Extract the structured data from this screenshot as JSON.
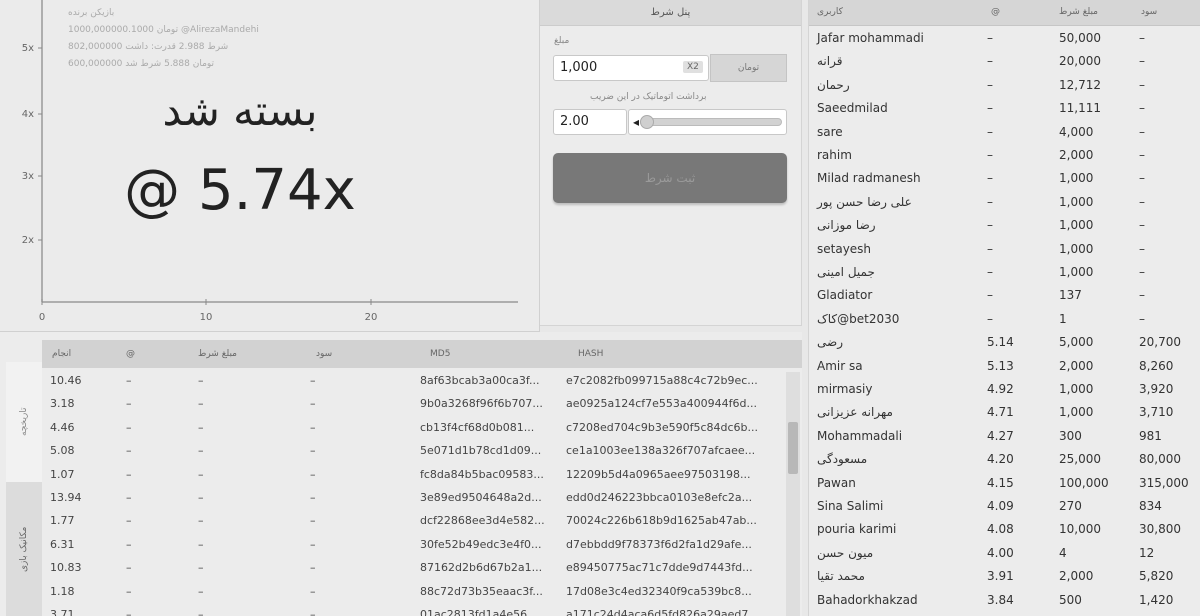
{
  "chart": {
    "info_lines": [
      "بازیکن برنده",
      "1000,000000.1000 تومان @AlirezaMandehi",
      "802,000000 شرط 2.988 قدرت: داشت",
      "600,000000 تومان 5.888 شرط شد"
    ],
    "crash_status": "بسته شد",
    "crash_value": "@ 5.74x"
  },
  "chart_data": {
    "type": "line",
    "title": "",
    "yticks": [
      "5x",
      "4x",
      "3x",
      "2x"
    ],
    "xticks": [
      "0",
      "10",
      "20"
    ],
    "final_multiplier": 5.74,
    "series": []
  },
  "bet": {
    "title": "پنل شرط",
    "amount_label": "مبلغ",
    "amount_value": "1,000",
    "amount_unit": "X2",
    "amount_side_btn": "تومان",
    "auto_label": "برداشت اتوماتیک در این ضریب",
    "auto_value": "2.00",
    "place_button": "ثبت شرط"
  },
  "players": {
    "headers": {
      "user": "کاربری",
      "multiplier": "@",
      "bet": "مبلغ شرط",
      "profit": "سود"
    },
    "rows": [
      {
        "user": "Jafar mohammadi",
        "mult": "–",
        "bet": "50,000",
        "profit": "–"
      },
      {
        "user": "قرانه",
        "mult": "–",
        "bet": "20,000",
        "profit": "–"
      },
      {
        "user": "رحمان",
        "mult": "–",
        "bet": "12,712",
        "profit": "–"
      },
      {
        "user": "Saeedmilad",
        "mult": "–",
        "bet": "11,111",
        "profit": "–"
      },
      {
        "user": "sare",
        "mult": "–",
        "bet": "4,000",
        "profit": "–"
      },
      {
        "user": "rahim",
        "mult": "–",
        "bet": "2,000",
        "profit": "–"
      },
      {
        "user": "Milad radmanesh",
        "mult": "–",
        "bet": "1,000",
        "profit": "–"
      },
      {
        "user": "علی رضا حسن پور",
        "mult": "–",
        "bet": "1,000",
        "profit": "–"
      },
      {
        "user": "رضا موزانی",
        "mult": "–",
        "bet": "1,000",
        "profit": "–"
      },
      {
        "user": "setayesh",
        "mult": "–",
        "bet": "1,000",
        "profit": "–"
      },
      {
        "user": "جمیل امینی",
        "mult": "–",
        "bet": "1,000",
        "profit": "–"
      },
      {
        "user": "Gladiator",
        "mult": "–",
        "bet": "137",
        "profit": "–"
      },
      {
        "user": "کاک@bet2030",
        "mult": "–",
        "bet": "1",
        "profit": "–"
      },
      {
        "user": "رضی",
        "mult": "5.14",
        "bet": "5,000",
        "profit": "20,700"
      },
      {
        "user": "Amir sa",
        "mult": "5.13",
        "bet": "2,000",
        "profit": "8,260"
      },
      {
        "user": "mirmasiy",
        "mult": "4.92",
        "bet": "1,000",
        "profit": "3,920"
      },
      {
        "user": "مهرانه عزیزانی",
        "mult": "4.71",
        "bet": "1,000",
        "profit": "3,710"
      },
      {
        "user": "Mohammadali",
        "mult": "4.27",
        "bet": "300",
        "profit": "981"
      },
      {
        "user": "مسعودگی",
        "mult": "4.20",
        "bet": "25,000",
        "profit": "80,000"
      },
      {
        "user": "Pawan",
        "mult": "4.15",
        "bet": "100,000",
        "profit": "315,000"
      },
      {
        "user": "Sina Salimi",
        "mult": "4.09",
        "bet": "270",
        "profit": "834"
      },
      {
        "user": "pouria karimi",
        "mult": "4.08",
        "bet": "10,000",
        "profit": "30,800"
      },
      {
        "user": "میون حسن",
        "mult": "4.00",
        "bet": "4",
        "profit": "12"
      },
      {
        "user": "محمد تقیا",
        "mult": "3.91",
        "bet": "2,000",
        "profit": "5,820"
      },
      {
        "user": "Bahadorkhakzad",
        "mult": "3.84",
        "bet": "500",
        "profit": "1,420"
      }
    ]
  },
  "history": {
    "tabs": [
      "تاریخچه",
      "مکانیک بازی"
    ],
    "headers": {
      "crash": "انجام",
      "mult": "@",
      "bet": "مبلغ شرط",
      "profit": "سود",
      "md5": "MD5",
      "hash": "HASH"
    },
    "rows": [
      {
        "crash": "10.46",
        "md5": "8af63bcab3a00ca3f...",
        "hash": "e7c2082fb099715a88c4c72b9ec..."
      },
      {
        "crash": "3.18",
        "md5": "9b0a3268f96f6b707...",
        "hash": "ae0925a124cf7e553a400944f6d..."
      },
      {
        "crash": "4.46",
        "md5": "cb13f4cf68d0b081...",
        "hash": "c7208ed704c9b3e590f5c84dc6b..."
      },
      {
        "crash": "5.08",
        "md5": "5e071d1b78cd1d09...",
        "hash": "ce1a1003ee138a326f707afcaee..."
      },
      {
        "crash": "1.07",
        "md5": "fc8da84b5bac09583...",
        "hash": "12209b5d4a0965aee97503198..."
      },
      {
        "crash": "13.94",
        "md5": "3e89ed9504648a2d...",
        "hash": "edd0d246223bbca0103e8efc2a..."
      },
      {
        "crash": "1.77",
        "md5": "dcf22868ee3d4e582...",
        "hash": "70024c226b618b9d1625ab47ab..."
      },
      {
        "crash": "6.31",
        "md5": "30fe52b49edc3e4f0...",
        "hash": "d7ebbdd9f78373f6d2fa1d29afe..."
      },
      {
        "crash": "10.83",
        "md5": "87162d2b6d67b2a1...",
        "hash": "e89450775ac71c7dde9d7443fd..."
      },
      {
        "crash": "1.18",
        "md5": "88c72d73b35eaac3f...",
        "hash": "17d08e3c4ed32340f9ca539bc8..."
      },
      {
        "crash": "3.71",
        "md5": "01ac2813fd1a4e56...",
        "hash": "a171c24d4aca6d5fd826a29aed7..."
      }
    ]
  }
}
